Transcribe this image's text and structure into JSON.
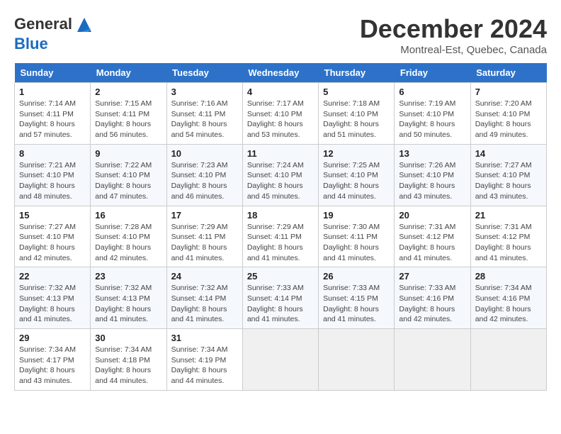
{
  "logo": {
    "line1": "General",
    "line2": "Blue"
  },
  "title": "December 2024",
  "location": "Montreal-Est, Quebec, Canada",
  "weekdays": [
    "Sunday",
    "Monday",
    "Tuesday",
    "Wednesday",
    "Thursday",
    "Friday",
    "Saturday"
  ],
  "weeks": [
    [
      {
        "day": "1",
        "sunrise": "Sunrise: 7:14 AM",
        "sunset": "Sunset: 4:11 PM",
        "daylight": "Daylight: 8 hours and 57 minutes."
      },
      {
        "day": "2",
        "sunrise": "Sunrise: 7:15 AM",
        "sunset": "Sunset: 4:11 PM",
        "daylight": "Daylight: 8 hours and 56 minutes."
      },
      {
        "day": "3",
        "sunrise": "Sunrise: 7:16 AM",
        "sunset": "Sunset: 4:11 PM",
        "daylight": "Daylight: 8 hours and 54 minutes."
      },
      {
        "day": "4",
        "sunrise": "Sunrise: 7:17 AM",
        "sunset": "Sunset: 4:10 PM",
        "daylight": "Daylight: 8 hours and 53 minutes."
      },
      {
        "day": "5",
        "sunrise": "Sunrise: 7:18 AM",
        "sunset": "Sunset: 4:10 PM",
        "daylight": "Daylight: 8 hours and 51 minutes."
      },
      {
        "day": "6",
        "sunrise": "Sunrise: 7:19 AM",
        "sunset": "Sunset: 4:10 PM",
        "daylight": "Daylight: 8 hours and 50 minutes."
      },
      {
        "day": "7",
        "sunrise": "Sunrise: 7:20 AM",
        "sunset": "Sunset: 4:10 PM",
        "daylight": "Daylight: 8 hours and 49 minutes."
      }
    ],
    [
      {
        "day": "8",
        "sunrise": "Sunrise: 7:21 AM",
        "sunset": "Sunset: 4:10 PM",
        "daylight": "Daylight: 8 hours and 48 minutes."
      },
      {
        "day": "9",
        "sunrise": "Sunrise: 7:22 AM",
        "sunset": "Sunset: 4:10 PM",
        "daylight": "Daylight: 8 hours and 47 minutes."
      },
      {
        "day": "10",
        "sunrise": "Sunrise: 7:23 AM",
        "sunset": "Sunset: 4:10 PM",
        "daylight": "Daylight: 8 hours and 46 minutes."
      },
      {
        "day": "11",
        "sunrise": "Sunrise: 7:24 AM",
        "sunset": "Sunset: 4:10 PM",
        "daylight": "Daylight: 8 hours and 45 minutes."
      },
      {
        "day": "12",
        "sunrise": "Sunrise: 7:25 AM",
        "sunset": "Sunset: 4:10 PM",
        "daylight": "Daylight: 8 hours and 44 minutes."
      },
      {
        "day": "13",
        "sunrise": "Sunrise: 7:26 AM",
        "sunset": "Sunset: 4:10 PM",
        "daylight": "Daylight: 8 hours and 43 minutes."
      },
      {
        "day": "14",
        "sunrise": "Sunrise: 7:27 AM",
        "sunset": "Sunset: 4:10 PM",
        "daylight": "Daylight: 8 hours and 43 minutes."
      }
    ],
    [
      {
        "day": "15",
        "sunrise": "Sunrise: 7:27 AM",
        "sunset": "Sunset: 4:10 PM",
        "daylight": "Daylight: 8 hours and 42 minutes."
      },
      {
        "day": "16",
        "sunrise": "Sunrise: 7:28 AM",
        "sunset": "Sunset: 4:10 PM",
        "daylight": "Daylight: 8 hours and 42 minutes."
      },
      {
        "day": "17",
        "sunrise": "Sunrise: 7:29 AM",
        "sunset": "Sunset: 4:11 PM",
        "daylight": "Daylight: 8 hours and 41 minutes."
      },
      {
        "day": "18",
        "sunrise": "Sunrise: 7:29 AM",
        "sunset": "Sunset: 4:11 PM",
        "daylight": "Daylight: 8 hours and 41 minutes."
      },
      {
        "day": "19",
        "sunrise": "Sunrise: 7:30 AM",
        "sunset": "Sunset: 4:11 PM",
        "daylight": "Daylight: 8 hours and 41 minutes."
      },
      {
        "day": "20",
        "sunrise": "Sunrise: 7:31 AM",
        "sunset": "Sunset: 4:12 PM",
        "daylight": "Daylight: 8 hours and 41 minutes."
      },
      {
        "day": "21",
        "sunrise": "Sunrise: 7:31 AM",
        "sunset": "Sunset: 4:12 PM",
        "daylight": "Daylight: 8 hours and 41 minutes."
      }
    ],
    [
      {
        "day": "22",
        "sunrise": "Sunrise: 7:32 AM",
        "sunset": "Sunset: 4:13 PM",
        "daylight": "Daylight: 8 hours and 41 minutes."
      },
      {
        "day": "23",
        "sunrise": "Sunrise: 7:32 AM",
        "sunset": "Sunset: 4:13 PM",
        "daylight": "Daylight: 8 hours and 41 minutes."
      },
      {
        "day": "24",
        "sunrise": "Sunrise: 7:32 AM",
        "sunset": "Sunset: 4:14 PM",
        "daylight": "Daylight: 8 hours and 41 minutes."
      },
      {
        "day": "25",
        "sunrise": "Sunrise: 7:33 AM",
        "sunset": "Sunset: 4:14 PM",
        "daylight": "Daylight: 8 hours and 41 minutes."
      },
      {
        "day": "26",
        "sunrise": "Sunrise: 7:33 AM",
        "sunset": "Sunset: 4:15 PM",
        "daylight": "Daylight: 8 hours and 41 minutes."
      },
      {
        "day": "27",
        "sunrise": "Sunrise: 7:33 AM",
        "sunset": "Sunset: 4:16 PM",
        "daylight": "Daylight: 8 hours and 42 minutes."
      },
      {
        "day": "28",
        "sunrise": "Sunrise: 7:34 AM",
        "sunset": "Sunset: 4:16 PM",
        "daylight": "Daylight: 8 hours and 42 minutes."
      }
    ],
    [
      {
        "day": "29",
        "sunrise": "Sunrise: 7:34 AM",
        "sunset": "Sunset: 4:17 PM",
        "daylight": "Daylight: 8 hours and 43 minutes."
      },
      {
        "day": "30",
        "sunrise": "Sunrise: 7:34 AM",
        "sunset": "Sunset: 4:18 PM",
        "daylight": "Daylight: 8 hours and 44 minutes."
      },
      {
        "day": "31",
        "sunrise": "Sunrise: 7:34 AM",
        "sunset": "Sunset: 4:19 PM",
        "daylight": "Daylight: 8 hours and 44 minutes."
      },
      null,
      null,
      null,
      null
    ]
  ]
}
